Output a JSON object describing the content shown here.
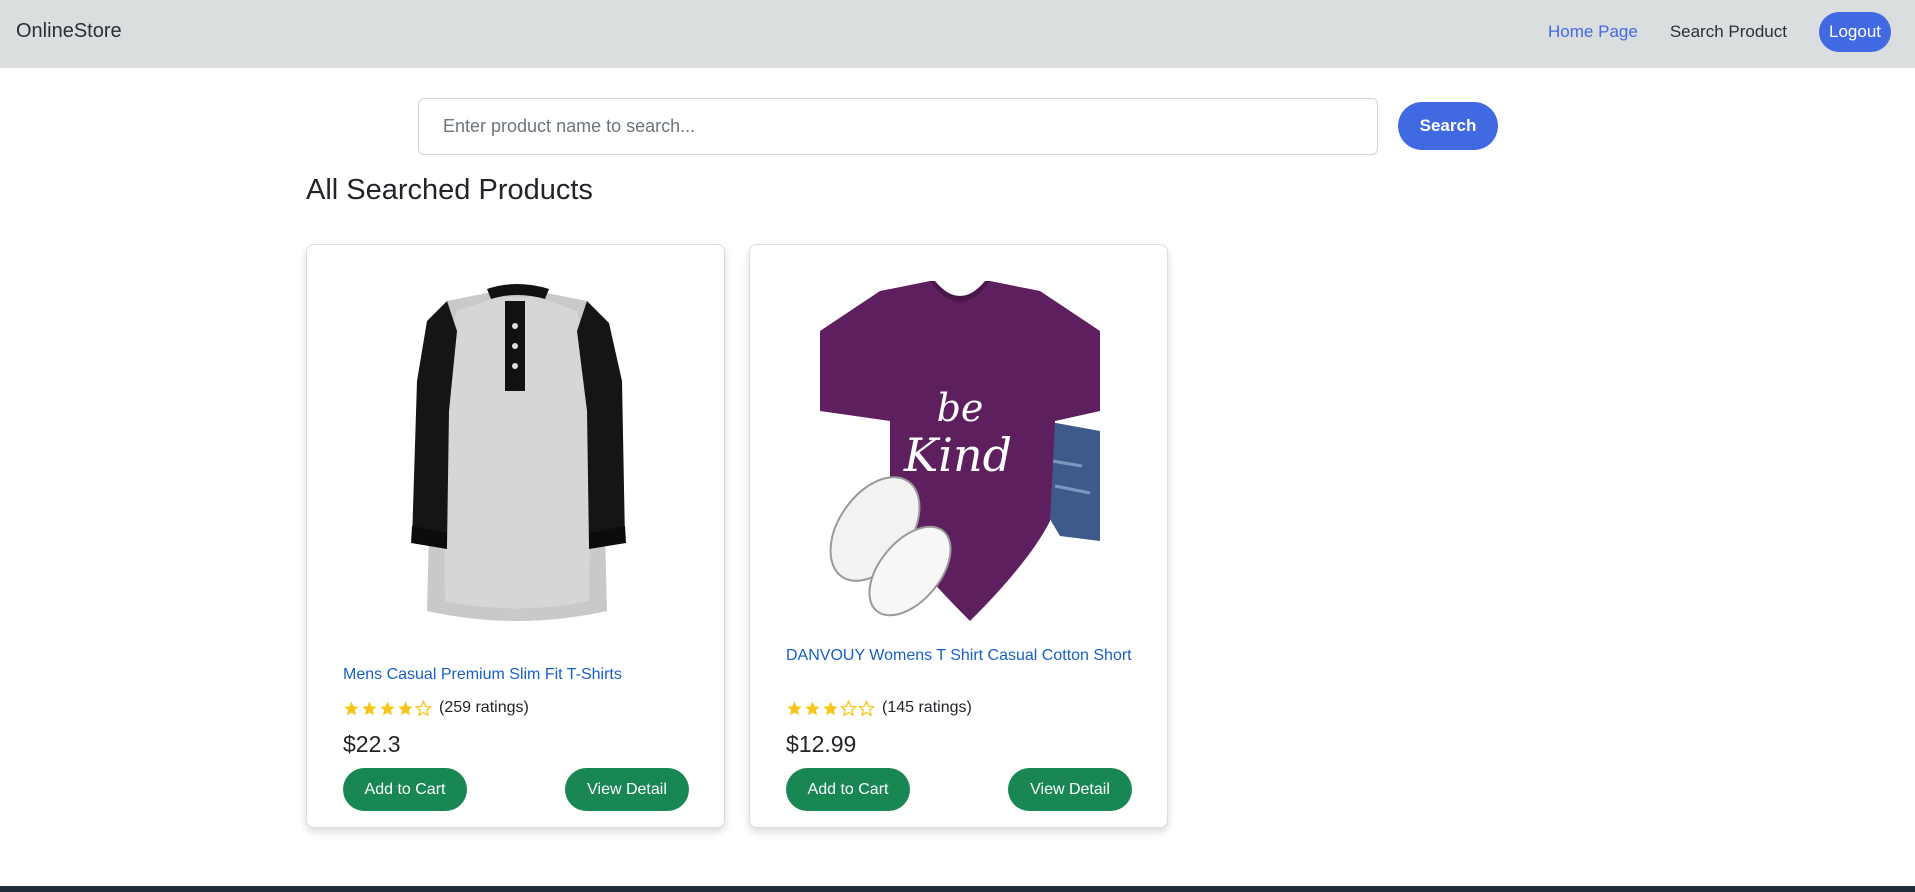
{
  "navbar": {
    "brand": "OnlineStore",
    "links": [
      {
        "label": "Home Page",
        "active": true
      },
      {
        "label": "Search Product",
        "active": false
      }
    ],
    "logout_label": "Logout"
  },
  "search": {
    "placeholder": "Enter product name to search...",
    "value": "",
    "button_label": "Search"
  },
  "section_title": "All Searched Products",
  "products": [
    {
      "title": "Mens Casual Premium Slim Fit T-Shirts",
      "rating_stars": 4,
      "ratings_text": "(259 ratings)",
      "price": "$22.3",
      "add_to_cart_label": "Add to Cart",
      "view_detail_label": "View Detail",
      "image_icon": "raglan-henley-shirt-image"
    },
    {
      "title": "DANVOUY Womens T Shirt Casual Cotton Short",
      "rating_stars": 3,
      "ratings_text": "(145 ratings)",
      "price": "$12.99",
      "add_to_cart_label": "Add to Cart",
      "view_detail_label": "View Detail",
      "image_icon": "be-kind-tshirt-image"
    }
  ],
  "colors": {
    "navbar_bg": "#dadedf",
    "accent_blue": "#4169e1",
    "button_green": "#198754",
    "link_blue": "#1a5fc4",
    "star_gold": "#f5c518"
  }
}
